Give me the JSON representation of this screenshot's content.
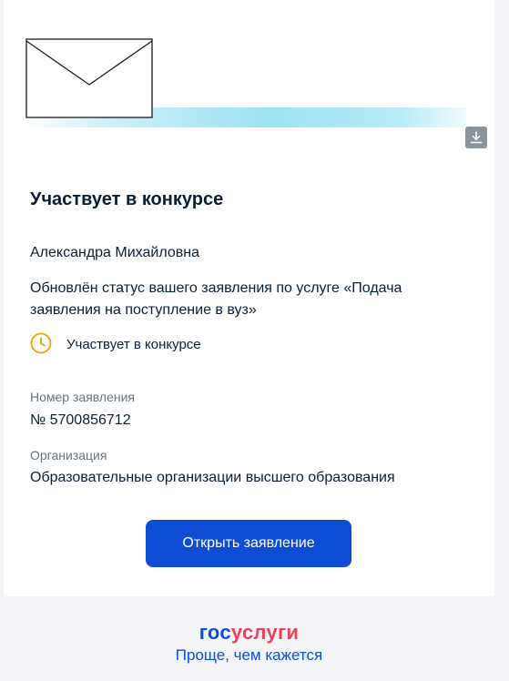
{
  "notification": {
    "title": "Участвует в конкурсе",
    "greeting": "Александра Михайловна",
    "message": "Обновлён статус вашего заявления по услуге «Подача заявления на поступление в вуз»",
    "status": {
      "text": "Участвует в конкурсе",
      "icon": "clock-icon",
      "icon_color": "#e8a400"
    },
    "fields": {
      "application_number_label": "Номер заявления",
      "application_number_value": "№ 5700856712",
      "organization_label": "Организация",
      "organization_value": "Образовательные организации высшего образования"
    },
    "open_button_label": "Открыть заявление",
    "download_icon": "download-icon"
  },
  "footer": {
    "logo_part1": "гос",
    "logo_part2": "услуги",
    "slogan": "Проще, чем кажется"
  },
  "colors": {
    "accent": "#0d4cd3",
    "brand_red": "#ee3f58",
    "text": "#0b1f33",
    "muted": "#66727f"
  }
}
